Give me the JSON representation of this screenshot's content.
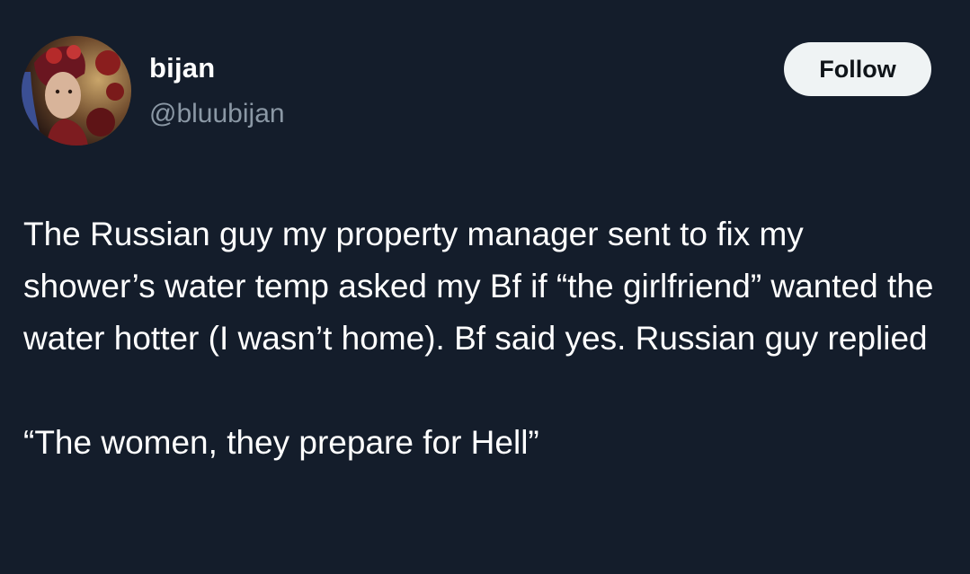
{
  "author": {
    "display_name": "bijan",
    "handle": "@bluubijan"
  },
  "follow_button": {
    "label": "Follow"
  },
  "tweet": {
    "paragraphs": [
      "The Russian guy my property manager sent to fix my shower’s water temp asked my Bf if “the girlfriend” wanted the water hotter (I wasn’t home). Bf said yes. Russian guy replied",
      "“The women, they prepare for Hell”"
    ]
  },
  "colors": {
    "background": "#141d2b",
    "text_primary": "#ffffff",
    "text_secondary": "#8b98a5",
    "button_background": "#eff3f4",
    "button_text": "#0f1419"
  },
  "icons": {
    "avatar": "profile-photo-avatar"
  }
}
